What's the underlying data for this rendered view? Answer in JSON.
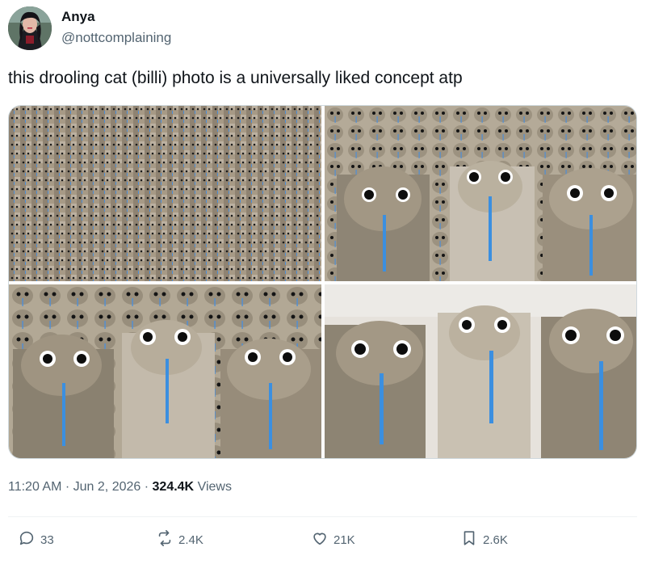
{
  "author": {
    "name": "Anya",
    "handle": "@nottcomplaining"
  },
  "tweet": {
    "text": "this drooling cat (billi) photo is a universally liked concept atp"
  },
  "meta": {
    "time": "11:20 AM",
    "separator": "·",
    "date": "Jun 2, 2026",
    "views_count": "324.4K",
    "views_label": "Views"
  },
  "actions": {
    "replies": "33",
    "reposts": "2.4K",
    "likes": "21K",
    "bookmarks": "2.6K"
  },
  "colors": {
    "text_primary": "#0f1419",
    "text_secondary": "#536471",
    "border": "#cfd9de",
    "drool": "#3b8fe0"
  },
  "icons": [
    "reply-icon",
    "repost-icon",
    "like-icon",
    "bookmark-icon"
  ]
}
